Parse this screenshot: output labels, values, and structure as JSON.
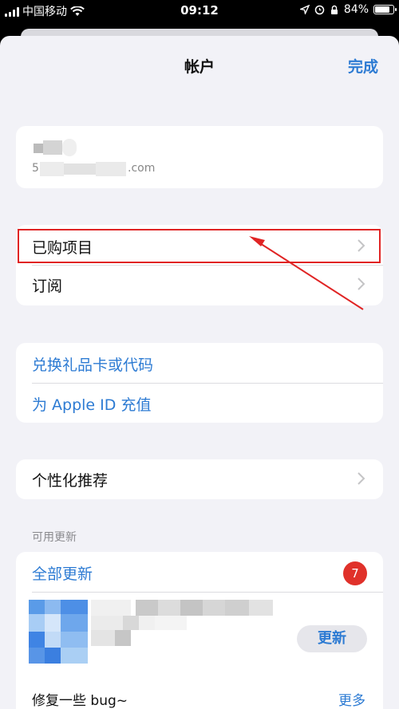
{
  "status_bar": {
    "carrier": "中国移动",
    "time": "09:12",
    "battery": "84%",
    "battery_level": 0.84
  },
  "nav": {
    "title": "帐户",
    "done_label": "完成"
  },
  "account": {
    "email_prefix": "5",
    "email_suffix": ".com"
  },
  "purchases": {
    "items": [
      {
        "label": "已购项目",
        "icon": "chevron-right-icon"
      },
      {
        "label": "订阅",
        "icon": "chevron-right-icon"
      }
    ]
  },
  "gift": {
    "redeem_label": "兑换礼品卡或代码",
    "add_funds_label": "为 Apple ID 充值"
  },
  "personalized": {
    "label": "个性化推荐"
  },
  "updates": {
    "section_header": "可用更新",
    "update_all_label": "全部更新",
    "badge_count": "7",
    "app": {
      "update_button": "更新",
      "release_notes": "修复一些 bug~",
      "more_label": "更多"
    }
  },
  "colors": {
    "accent": "#2d7bd3",
    "badge": "#e0312a",
    "highlight": "#e02424"
  }
}
